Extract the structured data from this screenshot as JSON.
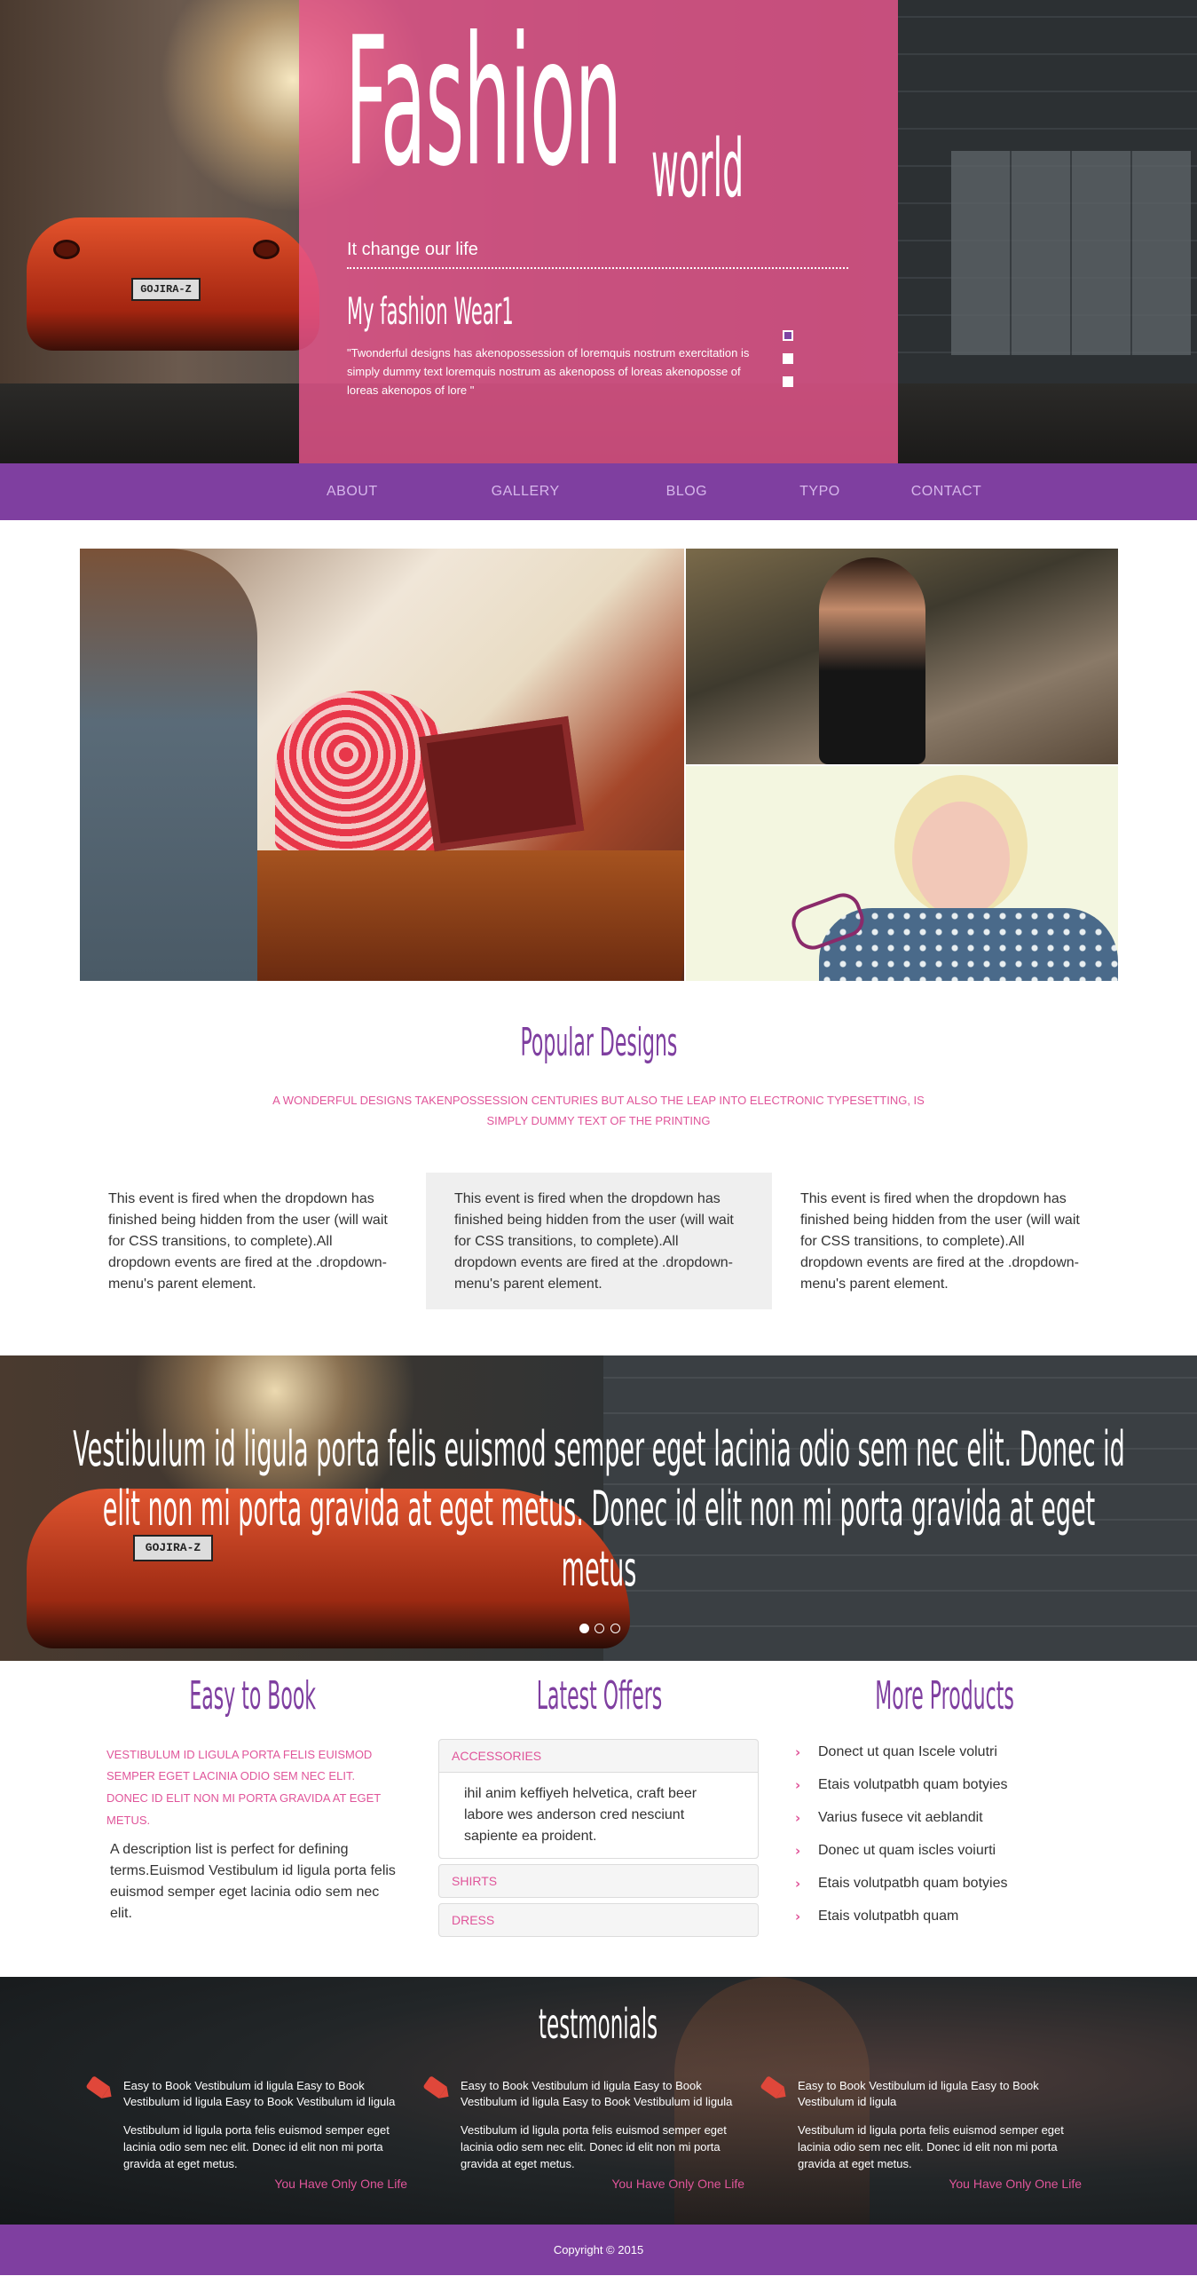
{
  "hero": {
    "brand_big": "Fashion",
    "brand_small": "world",
    "tagline": "It change our life",
    "slide_title": "My fashion Wear1",
    "slide_text": "\"Twonderful designs has akenopossession of loremquis nostrum exercitation is simply dummy text loremquis nostrum as akenoposs of loreas akenoposse of loreas akenopos of lore \"",
    "car_plate": "GOJIRA-Z"
  },
  "nav": {
    "items": [
      "ABOUT",
      "GALLERY",
      "BLOG",
      "TYPO",
      "CONTACT"
    ]
  },
  "popular": {
    "title": "Popular Designs",
    "subtitle": "A WONDERFUL DESIGNS TAKENPOSSESSION CENTURIES BUT ALSO THE LEAP INTO ELECTRONIC TYPESETTING, IS SIMPLY DUMMY TEXT OF THE PRINTING",
    "columns": [
      "This event is fired when the dropdown has finished being hidden from the user (will wait for CSS transitions, to complete).All dropdown events are fired at the .dropdown-menu's parent element.",
      "This event is fired when the dropdown has finished being hidden from the user (will wait for CSS transitions, to complete).All dropdown events are fired at the .dropdown-menu's parent element.",
      "This event is fired when the dropdown has finished being hidden from the user (will wait for CSS transitions, to complete).All dropdown events are fired at the .dropdown-menu's parent element."
    ]
  },
  "banner": {
    "quote": "Vestibulum id ligula porta felis euismod semper eget lacinia odio sem nec elit. Donec id elit non mi porta gravida at eget metus. Donec id elit non mi porta gravida at eget metus",
    "car_plate": "GOJIRA-Z"
  },
  "easy": {
    "title": "Easy to Book",
    "highlight": "VESTIBULUM ID LIGULA PORTA FELIS EUISMOD SEMPER EGET LACINIA ODIO SEM NEC ELIT. DONEC ID ELIT NON MI PORTA GRAVIDA AT EGET METUS.",
    "description": "A description list is perfect for defining terms.Euismod Vestibulum id ligula porta felis euismod semper eget lacinia odio sem nec elit."
  },
  "offers": {
    "title": "Latest Offers",
    "items": [
      {
        "label": "ACCESSORIES",
        "body": "ihil anim keffiyeh helvetica, craft beer labore wes anderson cred nesciunt sapiente ea proident."
      },
      {
        "label": "SHIRTS"
      },
      {
        "label": "DRESS"
      }
    ]
  },
  "more": {
    "title": "More Products",
    "items": [
      "Donect ut quan Iscele volutri",
      "Etais volutpatbh quam botyies",
      "Varius fusece vit aeblandit",
      "Donec ut quam iscles voiurti",
      "Etais volutpatbh quam botyies",
      "Etais volutpatbh quam"
    ]
  },
  "testimonials": {
    "title": "testmonials",
    "cards": [
      {
        "heading": "Easy to Book Vestibulum id ligula Easy to Book Vestibulum id ligula Easy to Book Vestibulum id ligula",
        "text": "Vestibulum id ligula porta felis euismod semper eget lacinia odio sem nec elit. Donec id elit non mi porta gravida at eget metus.",
        "author": "You Have Only One Life"
      },
      {
        "heading": "Easy to Book Vestibulum id ligula Easy to Book Vestibulum id ligula Easy to Book Vestibulum id ligula",
        "text": "Vestibulum id ligula porta felis euismod semper eget lacinia odio sem nec elit. Donec id elit non mi porta gravida at eget metus.",
        "author": "You Have Only One Life"
      },
      {
        "heading": "Easy to Book Vestibulum id ligula Easy to Book Vestibulum id ligula",
        "text": "Vestibulum id ligula porta felis euismod semper eget lacinia odio sem nec elit. Donec id elit non mi porta gravida at eget metus.",
        "author": "You Have Only One Life"
      }
    ]
  },
  "footer": {
    "copyright": "Copyright © 2015"
  },
  "colors": {
    "purple": "#7f3fa0",
    "pink": "#e0559a",
    "hero_overlay": "#e8568c"
  }
}
